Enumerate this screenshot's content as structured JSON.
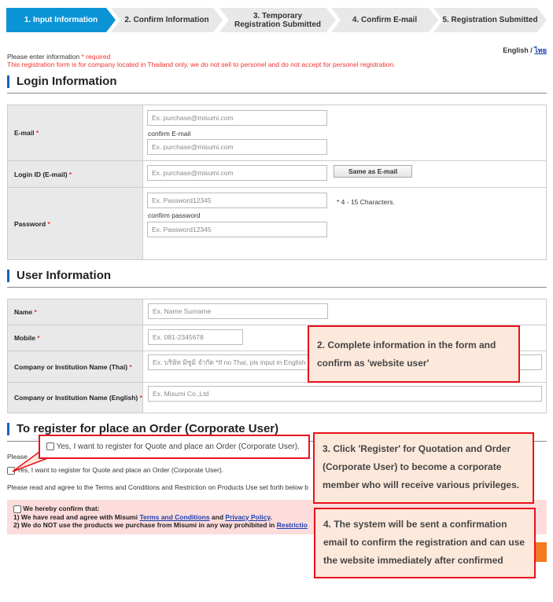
{
  "steps": [
    "1. Input Information",
    "2. Confirm Information",
    "3. Temporary Registration Submitted",
    "4. Confirm E-mail",
    "5. Registration Submitted"
  ],
  "lang": {
    "english": "English",
    "sep": " / ",
    "thai": "ไทย"
  },
  "notice": {
    "line1": "Please enter information ",
    "req": "* required",
    "line2": "This registration form is for company located in Thailand only, we do not sell to personel and do not accept for personel registration."
  },
  "login": {
    "title": "Login Information",
    "email_label": "E-mail",
    "email_ph": "Ex. purchase@misumi.com",
    "confirm_email_label": "confirm E-mail",
    "confirm_email_ph": "Ex. purchase@misumi.com",
    "loginid_label": "Login ID (E-mail)",
    "loginid_ph": "Ex. purchase@misumi.com",
    "same_button": "Same as E-mail",
    "password_label": "Password",
    "password_ph": "Ex. Password12345",
    "password_hint": "* 4 - 15 Characters.",
    "confirm_password_label": "confirm password",
    "confirm_password_ph": "Ex. Password12345"
  },
  "user": {
    "title": "User Information",
    "name_label": "Name",
    "name_ph": "Ex. Name Surname",
    "mobile_label": "Mobile",
    "mobile_ph": "Ex. 081-2345678",
    "company_thai_label": "Company or Institution Name (Thai)",
    "company_thai_ph": "Ex. บริษัท มิซูมิ จำกัด *If no Thai, pls input in English",
    "company_en_label": "Company or Institution Name (English)",
    "company_en_ph": "Ex. Misumi Co.,Ltd"
  },
  "required_mark": "*",
  "corporate": {
    "title": "To register for place an Order (Corporate User)",
    "please": "Please",
    "checkbox_label": "Yes, I want to register for Quote and place an Order (Corporate User).",
    "terms_text": "Please read and agree to the Terms and Conditions and Restriction on Products Use set forth below b"
  },
  "confirm": {
    "heading": "We hereby confirm that:",
    "l1a": "1) We have read and agree with Misumi ",
    "terms": "Terms and Conditions",
    "and": " and ",
    "privacy": "Privacy Policy",
    "dot": ".",
    "l2a": "2) We do NOT use the products we purchase from Misumi in any way prohibited in ",
    "restriction": "Restrictio"
  },
  "callouts": {
    "c1": "Yes, I want to register for Quote and place an Order (Corporate User).",
    "c2": "2. Complete information in the form and confirm as 'website user'",
    "c3": "3. Click 'Register' for Quotation and Order (Corporate User) to become a corporate member who will receive various privileges.",
    "c4": "4. The system will be sent a confirmation email to confirm the registration and can use the website immediately after confirmed"
  },
  "colors": {
    "accent": "#0a94d6",
    "callout_border": "#e8121c",
    "callout_bg": "#fde9dc",
    "required": "#e33",
    "submit": "#f47a20"
  }
}
